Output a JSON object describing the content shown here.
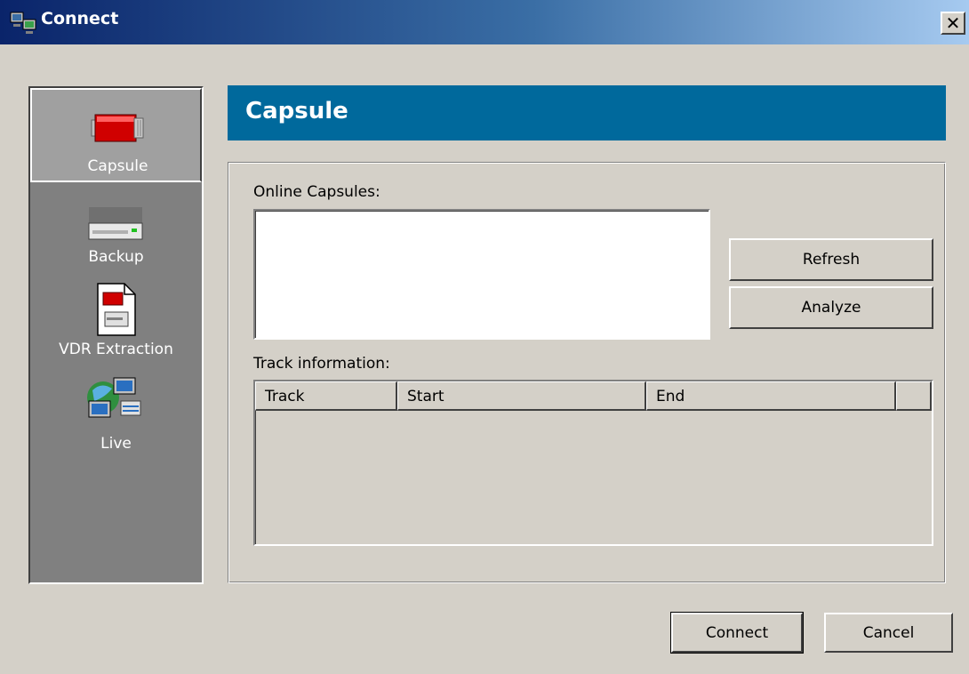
{
  "window": {
    "title": "Connect",
    "close_symbol": "✕"
  },
  "sidebar": {
    "items": [
      {
        "label": "Capsule",
        "icon": "capsule-icon",
        "active": true
      },
      {
        "label": "Backup",
        "icon": "backup-drive-icon",
        "active": false
      },
      {
        "label": "VDR Extraction",
        "icon": "vdr-extraction-icon",
        "active": false
      },
      {
        "label": "Live",
        "icon": "live-network-icon",
        "active": false
      }
    ]
  },
  "header": {
    "title": "Capsule",
    "color": "#00699c"
  },
  "capsule": {
    "online_label": "Online Capsules:",
    "online_items": [],
    "refresh_label": "Refresh",
    "analyze_label": "Analyze",
    "track_label": "Track information:",
    "track_columns": [
      "Track",
      "Start",
      "End"
    ],
    "track_rows": []
  },
  "footer": {
    "connect_label": "Connect",
    "cancel_label": "Cancel"
  }
}
